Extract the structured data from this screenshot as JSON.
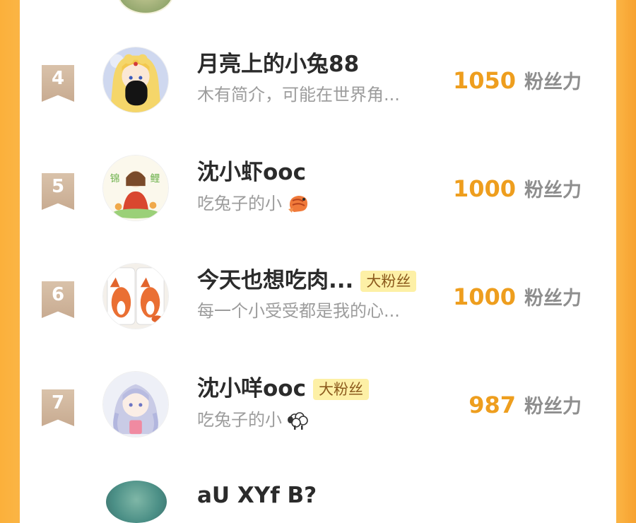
{
  "unit_label": "粉丝力",
  "rows": [
    {
      "rank": "4",
      "name": "月亮上的小兔88",
      "badge": "",
      "bio": "木有简介，可能在世界角...",
      "bio_emoji": "",
      "score": "1050"
    },
    {
      "rank": "5",
      "name": "沈小虾ooc",
      "badge": "",
      "bio": "吃兔子的小",
      "bio_emoji": "shrimp-emoji",
      "score": "1000"
    },
    {
      "rank": "6",
      "name": "今天也想吃肉...",
      "badge": "大粉丝",
      "bio": "每一个小受受都是我的心...",
      "bio_emoji": "",
      "score": "1000"
    },
    {
      "rank": "7",
      "name": "沈小咩ooc",
      "badge": "大粉丝",
      "bio": "吃兔子的小",
      "bio_emoji": "sheep-emoji",
      "score": "987"
    }
  ],
  "partial_next_name": "aU  XYf  B?"
}
